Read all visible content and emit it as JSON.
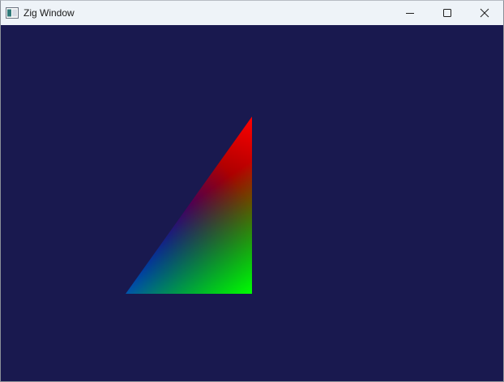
{
  "window": {
    "title": "Zig Window",
    "app_icon": "window-app-icon",
    "controls": {
      "minimize_icon": "minimize-icon",
      "maximize_icon": "maximize-icon",
      "close_icon": "close-icon"
    }
  },
  "canvas": {
    "clear_color": "#19194f",
    "triangle": {
      "vertex_colors": {
        "top": "#ff0000",
        "bottom_left": "#0000ff",
        "bottom_right": "#00ff00"
      }
    }
  }
}
